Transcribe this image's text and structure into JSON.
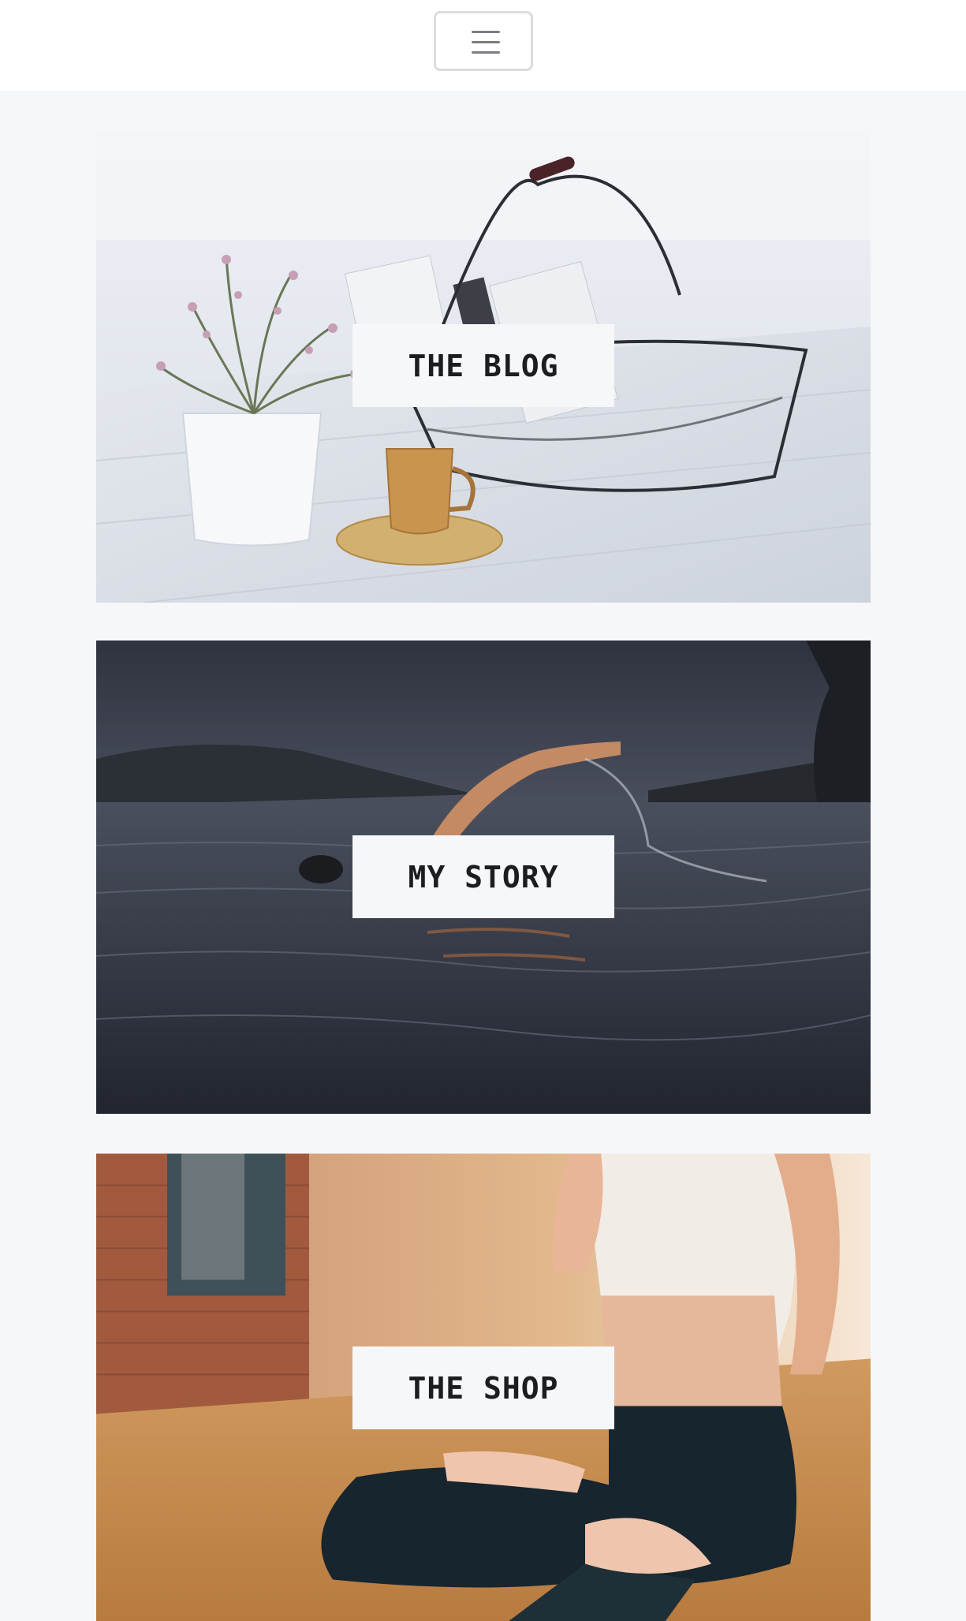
{
  "navbar": {
    "toggle_icon": "menu-hamburger-icon"
  },
  "cards": [
    {
      "label": "THE BLOG",
      "image": "still-life-plant-basket-coffee"
    },
    {
      "label": "MY STORY",
      "image": "swimmer-in-lake"
    },
    {
      "label": "THE SHOP",
      "image": "yoga-meditation-pose"
    }
  ]
}
